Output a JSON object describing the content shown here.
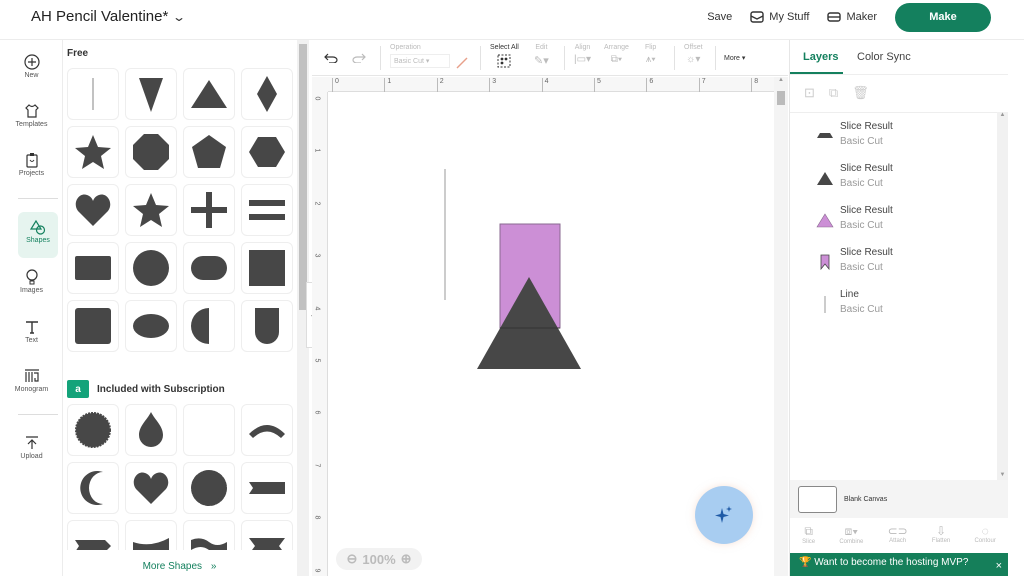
{
  "header": {
    "project_title": "AH Pencil Valentine*",
    "save_label": "Save",
    "mystuff_label": "My Stuff",
    "maker_label": "Maker",
    "make_label": "Make"
  },
  "nav": {
    "items": [
      {
        "label": "New",
        "icon": "plus-circle-icon"
      },
      {
        "label": "Templates",
        "icon": "shirt-icon"
      },
      {
        "label": "Projects",
        "icon": "clipboard-icon"
      },
      {
        "label": "Shapes",
        "icon": "shapes-icon"
      },
      {
        "label": "Images",
        "icon": "balloon-icon"
      },
      {
        "label": "Text",
        "icon": "text-icon"
      },
      {
        "label": "Monogram",
        "icon": "monogram-icon"
      },
      {
        "label": "Upload",
        "icon": "upload-icon"
      }
    ],
    "active": "Shapes"
  },
  "shapes_panel": {
    "free_heading": "Free",
    "free_shapes": [
      "line",
      "triangle-down",
      "triangle",
      "diamond",
      "star",
      "octagon",
      "pentagon",
      "hexagon",
      "heart",
      "star-small",
      "plus",
      "equals",
      "rectangle",
      "circle",
      "rounded-rect",
      "square",
      "rounded-square",
      "oval",
      "half-circle",
      "u-shape"
    ],
    "subscription_heading": "Included with Subscription",
    "subscription_badge": "a",
    "subscription_shapes": [
      "seal",
      "teardrop",
      "crescent",
      "arc",
      "crescent-left",
      "heart",
      "scallop-circle",
      "banner",
      "banner-arrow",
      "wavy-banner",
      "wavy-banner-2",
      "ribbon"
    ],
    "more_label": "More Shapes",
    "more_icon": "»"
  },
  "toolbar": {
    "operation_label": "Operation",
    "operation_value": "Basic Cut",
    "select_all_label": "Select All",
    "edit_label": "Edit",
    "align_label": "Align",
    "arrange_label": "Arrange",
    "flip_label": "Flip",
    "offset_label": "Offset",
    "more_label": "More ▾"
  },
  "ruler": {
    "h": [
      "0",
      "1",
      "2",
      "3",
      "4",
      "5",
      "6",
      "7",
      "8"
    ],
    "v": [
      "0",
      "1",
      "2",
      "3",
      "4",
      "5",
      "6",
      "7",
      "8",
      "9"
    ]
  },
  "canvas": {
    "zoom": "100%",
    "colors": {
      "purple": "#cc8fd6",
      "dark": "#474747",
      "line": "#aaaaaa"
    }
  },
  "layers_panel": {
    "tabs": [
      "Layers",
      "Color Sync"
    ],
    "active_tab": "Layers",
    "items": [
      {
        "name": "Slice Result",
        "sub": "Basic Cut",
        "icon": "trapezoid-icon",
        "color": "#474747"
      },
      {
        "name": "Slice Result",
        "sub": "Basic Cut",
        "icon": "triangle-icon",
        "color": "#474747"
      },
      {
        "name": "Slice Result",
        "sub": "Basic Cut",
        "icon": "triangle-icon",
        "color": "#cc8fd6"
      },
      {
        "name": "Slice Result",
        "sub": "Basic Cut",
        "icon": "notched-rect-icon",
        "color": "#cc8fd6"
      },
      {
        "name": "Line",
        "sub": "Basic Cut",
        "icon": "line-icon",
        "color": "#999999"
      }
    ],
    "blank_canvas_label": "Blank Canvas",
    "actions": [
      "Slice",
      "Combine",
      "Attach",
      "Flatten",
      "Contour"
    ],
    "toast": "Want to become the hosting MVP?",
    "toast_close": "×"
  }
}
